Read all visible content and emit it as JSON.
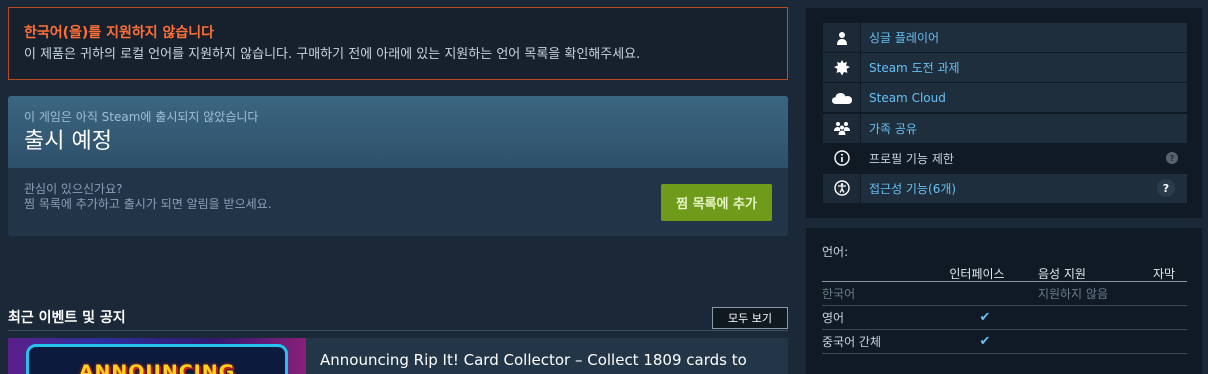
{
  "language_warning": {
    "title": "한국어(을)를 지원하지 않습니다",
    "text": "이 제품은 귀하의 로컬 언어를 지원하지 않습니다. 구매하기 전에 아래에 있는 지원하는 언어 목록을 확인해주세요."
  },
  "coming_soon": {
    "subtitle": "이 게임은 아직 Steam에 출시되지 않았습니다",
    "title": "출시 예정",
    "question": "관심이 있으신가요?",
    "description": "찜 목록에 추가하고 출시가 되면 알림을 받으세요.",
    "wishlist_button": "찜 목록에 추가"
  },
  "events": {
    "title": "최근 이벤트 및 공지",
    "view_all": "모두 보기",
    "first_event_image_text": "ANNOUNCING",
    "first_event_title": "Announcing Rip It! Card Collector – Collect 1809 cards to"
  },
  "features": [
    {
      "icon": "single-player-icon",
      "label": "싱글 플레이어"
    },
    {
      "icon": "achievements-icon",
      "label": "Steam 도전 과제"
    },
    {
      "icon": "cloud-icon",
      "label": "Steam Cloud"
    },
    {
      "icon": "family-sharing-icon",
      "label": "가족 공유"
    },
    {
      "icon": "info-icon",
      "label": "프로필 기능 제한",
      "help": "?"
    },
    {
      "icon": "accessibility-icon",
      "label": "접근성 기능(6개)",
      "help": "?"
    }
  ],
  "languages": {
    "header": "언어:",
    "columns": [
      "인터페이스",
      "음성 지원",
      "자막"
    ],
    "rows": [
      {
        "name": "한국어",
        "status": "지원하지 않음"
      },
      {
        "name": "영어",
        "interface": "✔"
      },
      {
        "name": "중국어 간체",
        "interface": "✔"
      }
    ]
  },
  "colors": {
    "background": "#1b2838",
    "warning_accent": "#ff6f37",
    "link": "#66c0f4",
    "wishlist_button": "#6f9b1a"
  }
}
